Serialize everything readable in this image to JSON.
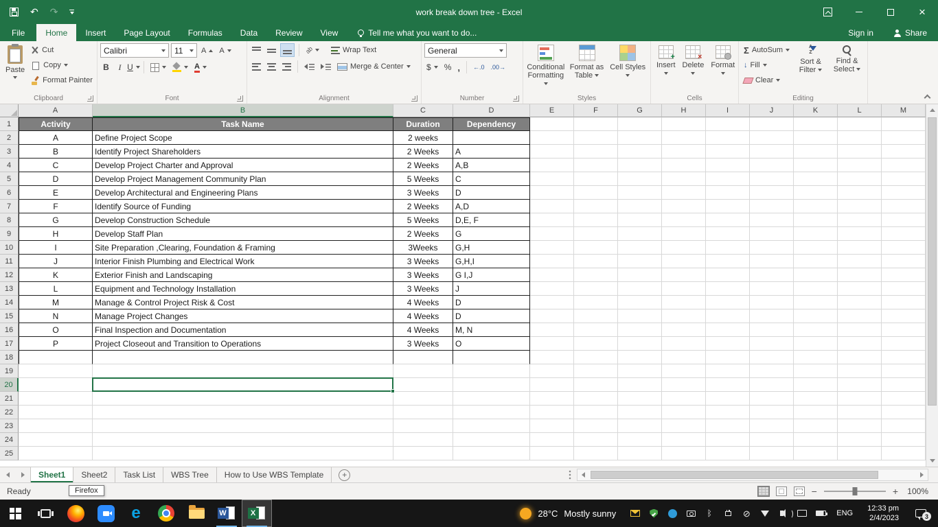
{
  "titlebar": {
    "title": "work break down tree - Excel"
  },
  "ribbon_tabs": {
    "file": "File",
    "home": "Home",
    "insert": "Insert",
    "page_layout": "Page Layout",
    "formulas": "Formulas",
    "data": "Data",
    "review": "Review",
    "view": "View",
    "tell_me": "Tell me what you want to do...",
    "sign_in": "Sign in",
    "share": "Share"
  },
  "ribbon": {
    "clipboard": {
      "title": "Clipboard",
      "paste": "Paste",
      "cut": "Cut",
      "copy": "Copy",
      "format_painter": "Format Painter"
    },
    "font": {
      "title": "Font",
      "family": "Calibri",
      "size": "11",
      "bold": "B",
      "italic": "I",
      "underline": "U"
    },
    "alignment": {
      "title": "Alignment",
      "wrap_text": "Wrap Text",
      "merge_center": "Merge & Center"
    },
    "number": {
      "title": "Number",
      "format": "General",
      "currency": "$",
      "percent": "%",
      "comma": ","
    },
    "styles": {
      "title": "Styles",
      "conditional_formatting": "Conditional Formatting",
      "format_as_table": "Format as Table",
      "cell_styles": "Cell Styles"
    },
    "cells": {
      "title": "Cells",
      "insert": "Insert",
      "delete": "Delete",
      "format": "Format"
    },
    "editing": {
      "title": "Editing",
      "autosum": "AutoSum",
      "fill": "Fill",
      "clear": "Clear",
      "sort_filter": "Sort & Filter",
      "find_select": "Find & Select"
    }
  },
  "grid": {
    "columns": [
      "A",
      "B",
      "C",
      "D",
      "E",
      "F",
      "G",
      "H",
      "I",
      "J",
      "K",
      "L",
      "M"
    ],
    "row_count": 25,
    "selected_cell": "B20",
    "selected_col": "B",
    "selected_row": 20,
    "table": {
      "headers": [
        "Activity",
        "Task Name",
        "Duration",
        "Dependency"
      ],
      "rows": [
        [
          "A",
          "Define Project Scope",
          "2 weeks",
          ""
        ],
        [
          "B",
          "Identify Project Shareholders",
          "2 Weeks",
          "A"
        ],
        [
          "C",
          "Develop Project Charter and Approval",
          "2 Weeks",
          "A,B"
        ],
        [
          "D",
          "Develop Project Management Community Plan",
          "5 Weeks",
          "C"
        ],
        [
          "E",
          "Develop Architectural and Engineering Plans",
          "3  Weeks",
          "D"
        ],
        [
          "F",
          "Identify Source of Funding",
          "2 Weeks",
          "A,D"
        ],
        [
          "G",
          "Develop Construction Schedule",
          "5 Weeks",
          "D,E, F"
        ],
        [
          "H",
          "Develop Staff Plan",
          "2 Weeks",
          "G"
        ],
        [
          "I",
          "Site Preparation ,Clearing, Foundation & Framing",
          "3Weeks",
          "G,H"
        ],
        [
          "J",
          "Interior Finish Plumbing and Electrical Work",
          "3 Weeks",
          "G,H,I"
        ],
        [
          "K",
          "Exterior Finish and Landscaping",
          "3 Weeks",
          "G I,J"
        ],
        [
          "L",
          "Equipment and Technology Installation",
          "3 Weeks",
          "J"
        ],
        [
          "M",
          "Manage & Control Project Risk & Cost",
          "4 Weeks",
          "D"
        ],
        [
          "N",
          "Manage Project Changes",
          "4 Weeks",
          "D"
        ],
        [
          "O",
          "Final Inspection and Documentation",
          "4 Weeks",
          "M, N"
        ],
        [
          "P",
          "Project Closeout and Transition to Operations",
          "3 Weeks",
          "O"
        ]
      ]
    }
  },
  "sheets": {
    "tabs": [
      "Sheet1",
      "Sheet2",
      "Task List",
      "WBS Tree",
      "How to Use WBS Template"
    ],
    "active_index": 0
  },
  "statusbar": {
    "mode": "Ready",
    "tooltip": "Firefox",
    "zoom": "100%"
  },
  "taskbar": {
    "weather_temp": "28°C",
    "weather_desc": "Mostly sunny",
    "language": "ENG",
    "time": "12:33 pm",
    "date": "2/4/2023",
    "notification_count": "3"
  }
}
